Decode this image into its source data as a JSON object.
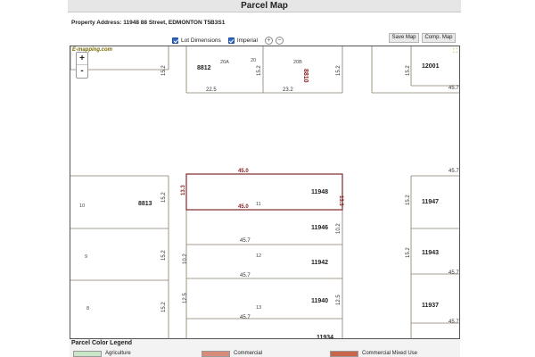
{
  "window": {
    "title": "Parcel Map"
  },
  "address": {
    "text": "Property Address: 11948 88 Street, EDMONTON T5B3S1"
  },
  "toggles": {
    "lot_dimensions": {
      "label": "Lot Dimensions",
      "checked": true
    },
    "imperial": {
      "label": "Imperial",
      "checked": true
    }
  },
  "buttons": {
    "save_map": "Save Map",
    "comp_map": "Comp. Map"
  },
  "map": {
    "brand": "E-mapping.com",
    "zoom_in": "+",
    "zoom_out": "-",
    "labels": [
      {
        "key": "8812",
        "text": "8812",
        "kind": "address"
      },
      {
        "key": "20A",
        "text": "20A",
        "kind": "lot"
      },
      {
        "key": "20a",
        "text": "20",
        "kind": "lot"
      },
      {
        "key": "20B",
        "text": "20B",
        "kind": "lot"
      },
      {
        "key": "8810",
        "text": "8810",
        "kind": "address-red"
      },
      {
        "key": "12001",
        "text": "12001",
        "kind": "address"
      },
      {
        "key": "d152a",
        "text": "15.2",
        "kind": "dim"
      },
      {
        "key": "d152b",
        "text": "15.2",
        "kind": "dim"
      },
      {
        "key": "d152c",
        "text": "15.2",
        "kind": "dim"
      },
      {
        "key": "d225",
        "text": "22.5",
        "kind": "dim"
      },
      {
        "key": "d232",
        "text": "23.2",
        "kind": "dim"
      },
      {
        "key": "d457a",
        "text": "45.7",
        "kind": "dim"
      },
      {
        "key": "d457b",
        "text": "45.7",
        "kind": "dim"
      },
      {
        "key": "l10",
        "text": "10",
        "kind": "lot"
      },
      {
        "key": "8813",
        "text": "8813",
        "kind": "address"
      },
      {
        "key": "d152d",
        "text": "15.2",
        "kind": "dim"
      },
      {
        "key": "d457c",
        "text": "45.0",
        "kind": "dim-red"
      },
      {
        "key": "d457d",
        "text": "45.0",
        "kind": "dim-red"
      },
      {
        "key": "l11",
        "text": "11",
        "kind": "lot"
      },
      {
        "key": "11948",
        "text": "11948",
        "kind": "address"
      },
      {
        "key": "d133a",
        "text": "13.3",
        "kind": "dim-red"
      },
      {
        "key": "d133b",
        "text": "13.3",
        "kind": "dim-red"
      },
      {
        "key": "11947",
        "text": "11947",
        "kind": "address"
      },
      {
        "key": "d152e",
        "text": "15.2",
        "kind": "dim"
      },
      {
        "key": "11946",
        "text": "11946",
        "kind": "address"
      },
      {
        "key": "d102a",
        "text": "10.2",
        "kind": "dim"
      },
      {
        "key": "d457e",
        "text": "45.7",
        "kind": "dim"
      },
      {
        "key": "l9",
        "text": "9",
        "kind": "lot"
      },
      {
        "key": "d152f",
        "text": "15.2",
        "kind": "dim"
      },
      {
        "key": "d102b",
        "text": "10.2",
        "kind": "dim"
      },
      {
        "key": "l12",
        "text": "12",
        "kind": "lot"
      },
      {
        "key": "11942",
        "text": "11942",
        "kind": "address"
      },
      {
        "key": "11943",
        "text": "11943",
        "kind": "address"
      },
      {
        "key": "d152g",
        "text": "15.2",
        "kind": "dim"
      },
      {
        "key": "d457f",
        "text": "45.7",
        "kind": "dim"
      },
      {
        "key": "d457g",
        "text": "45.7",
        "kind": "dim"
      },
      {
        "key": "l8",
        "text": "8",
        "kind": "lot"
      },
      {
        "key": "d152h",
        "text": "15.2",
        "kind": "dim"
      },
      {
        "key": "d125a",
        "text": "12.5",
        "kind": "dim"
      },
      {
        "key": "l13",
        "text": "13",
        "kind": "lot"
      },
      {
        "key": "11940",
        "text": "11940",
        "kind": "address"
      },
      {
        "key": "d125b",
        "text": "12.5",
        "kind": "dim"
      },
      {
        "key": "d152i",
        "text": "15.2",
        "kind": "dim"
      },
      {
        "key": "11937",
        "text": "11937",
        "kind": "address"
      },
      {
        "key": "d457h",
        "text": "45.7",
        "kind": "dim"
      },
      {
        "key": "d457i",
        "text": "45.7",
        "kind": "dim"
      },
      {
        "key": "11934",
        "text": "11934",
        "kind": "address"
      }
    ]
  },
  "legend": {
    "title": "Parcel Color Legend",
    "items": [
      {
        "label": "Agriculture",
        "color": "#c9e6c9"
      },
      {
        "label": "Commercial",
        "color": "#d98b7a"
      },
      {
        "label": "Commercial Mixed Use",
        "color": "#c9654a"
      }
    ]
  },
  "colors": {
    "parcel_line": "#8a7b6a",
    "subject_line": "#7a2a2a",
    "red_text": "#8a2020"
  }
}
